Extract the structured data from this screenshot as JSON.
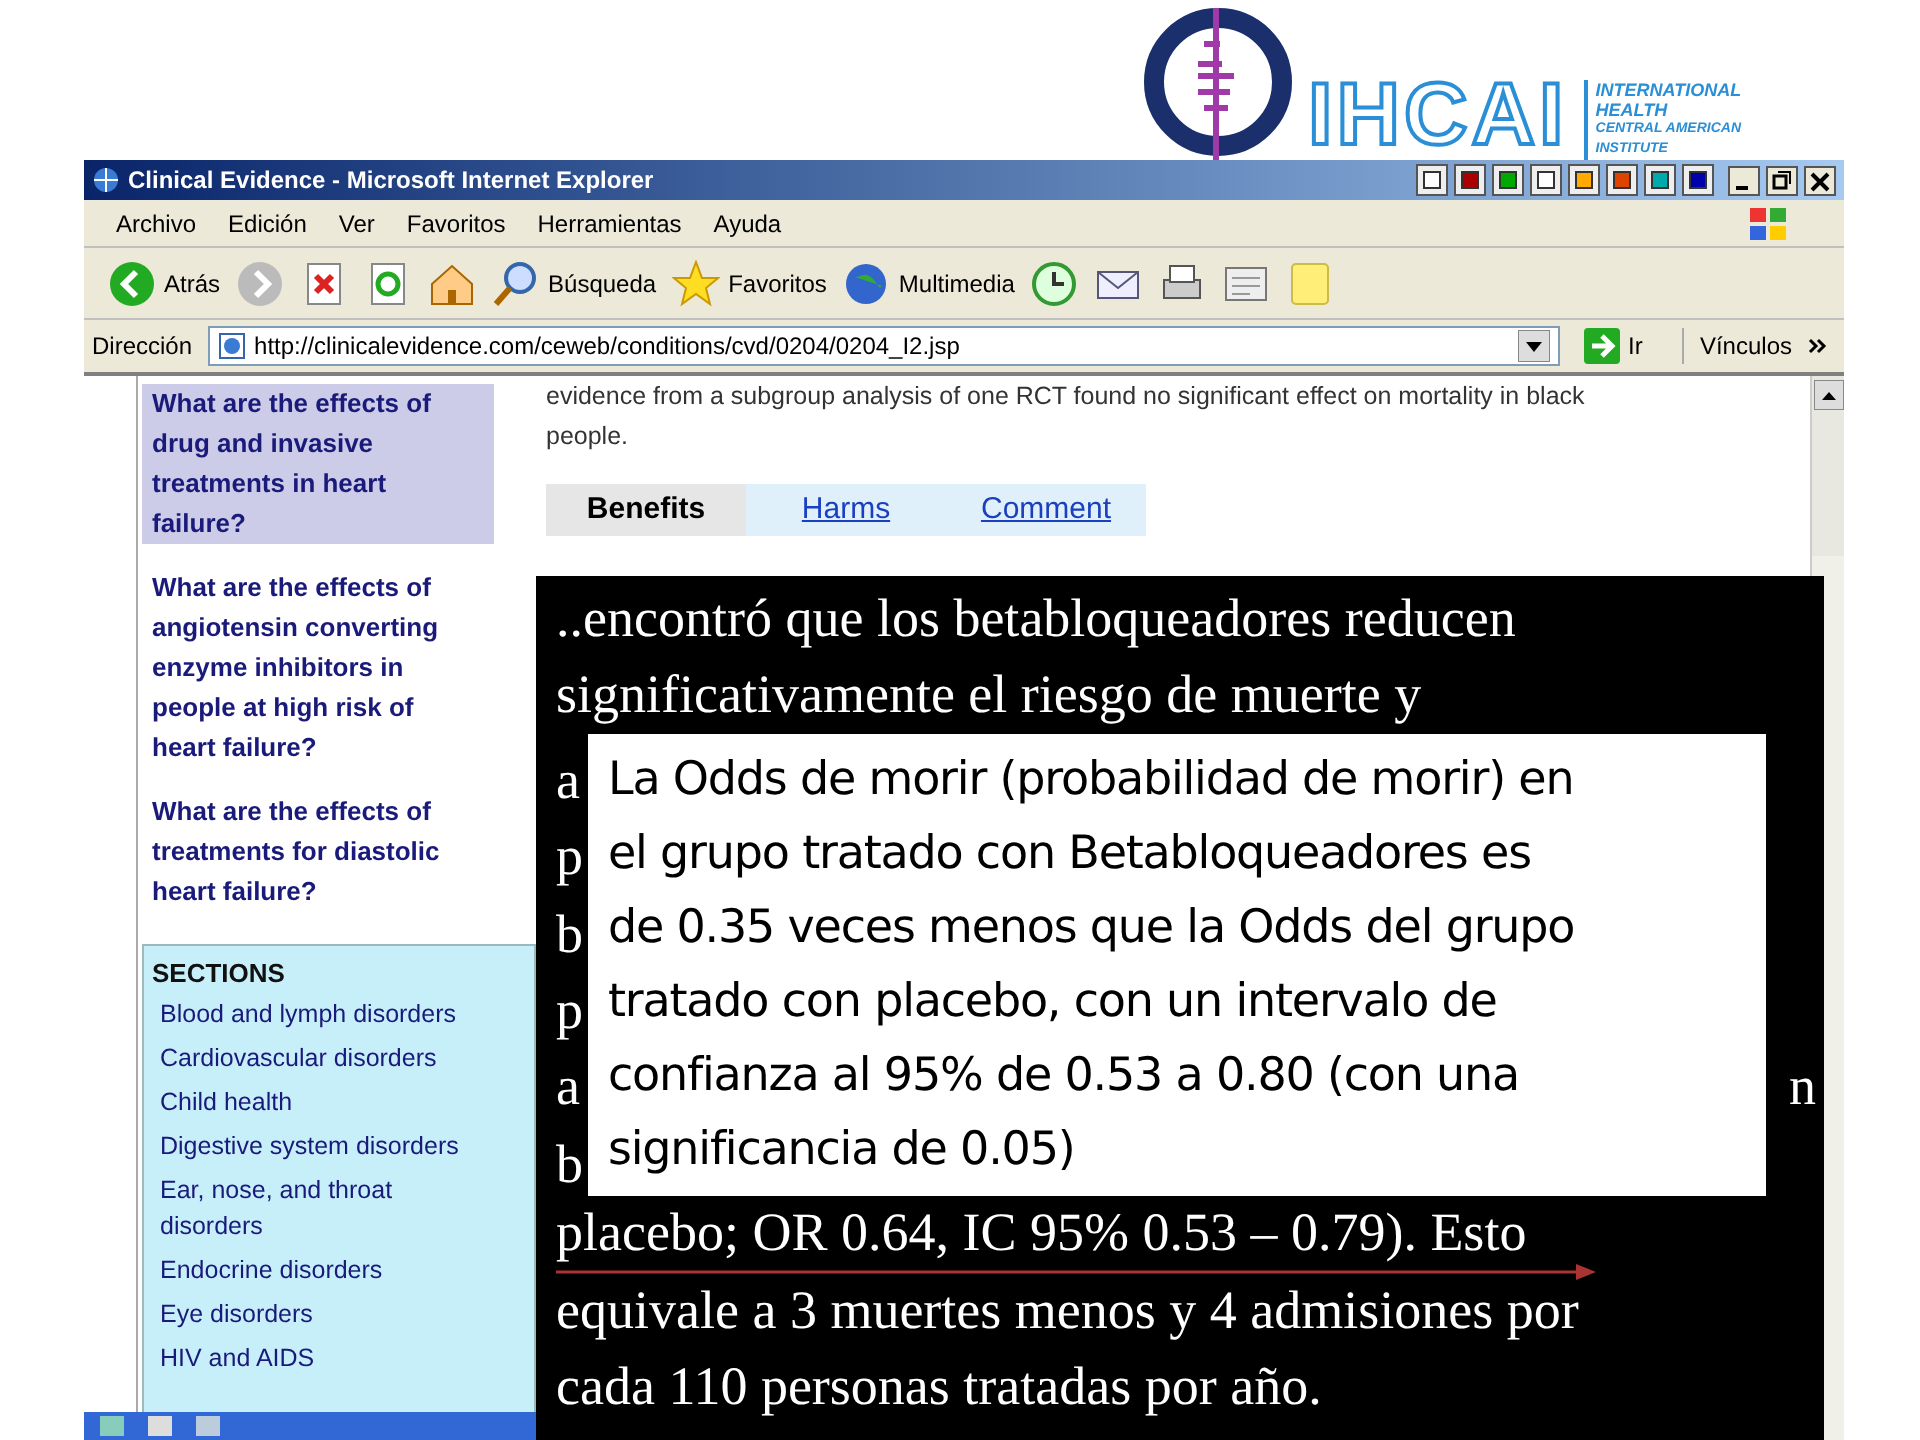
{
  "logo": {
    "name": "IHCAI",
    "subtitle": [
      "INTERNATIONAL",
      "HEALTH",
      "CENTRAL AMERICAN",
      "INSTITUTE"
    ]
  },
  "browser": {
    "title": "Clinical Evidence - Microsoft Internet Explorer",
    "menu": [
      "Archivo",
      "Edición",
      "Ver",
      "Favoritos",
      "Herramientas",
      "Ayuda"
    ],
    "toolbar": [
      {
        "kind": "back",
        "label": "Atrás"
      },
      {
        "kind": "forward"
      },
      {
        "kind": "stop"
      },
      {
        "kind": "refresh"
      },
      {
        "kind": "home"
      },
      {
        "kind": "search",
        "label": "Búsqueda"
      },
      {
        "kind": "favorites",
        "label": "Favoritos"
      },
      {
        "kind": "media",
        "label": "Multimedia"
      },
      {
        "kind": "history"
      },
      {
        "kind": "mail"
      },
      {
        "kind": "print"
      },
      {
        "kind": "edit"
      },
      {
        "kind": "note"
      }
    ],
    "address": {
      "label": "Dirección",
      "url": "http://clinicalevidence.com/ceweb/conditions/cvd/0204/0204_I2.jsp",
      "go": "Ir",
      "links": "Vínculos"
    }
  },
  "sidebar": {
    "questions": [
      {
        "text": "What are the effects of drug and invasive treatments in heart failure?",
        "selected": true
      },
      {
        "text": "What are the effects of angiotensin converting enzyme inhibitors in people at high risk of heart failure?",
        "selected": false
      },
      {
        "text": "What are the effects of treatments for diastolic heart failure?",
        "selected": false
      }
    ],
    "sections": {
      "heading": "SECTIONS",
      "items": [
        "Blood and lymph disorders",
        "Cardiovascular disorders",
        "Child health",
        "Digestive system disorders",
        "Ear, nose, and throat disorders",
        "Endocrine disorders",
        "Eye disorders",
        "HIV and AIDS"
      ]
    }
  },
  "content": {
    "intro": "evidence from a subgroup analysis of one RCT found no significant effect on mortality in black people.",
    "tabs": [
      {
        "label": "Benefits",
        "selected": true
      },
      {
        "label": "Harms",
        "selected": false
      },
      {
        "label": "Comment",
        "selected": false
      }
    ]
  },
  "slide_panel": {
    "lines": [
      {
        "kind": "full",
        "text": "..encontró que los betabloqueadores reducen"
      },
      {
        "kind": "full",
        "text": "significativamente el riesgo de muerte y"
      },
      {
        "kind": "fragment",
        "left": "a"
      },
      {
        "kind": "fragment",
        "left": "p"
      },
      {
        "kind": "fragment",
        "left": "b"
      },
      {
        "kind": "fragment",
        "left": "p"
      },
      {
        "kind": "fragment",
        "left": "a",
        "right": "n"
      },
      {
        "kind": "fragment",
        "left": "b"
      },
      {
        "kind": "full",
        "text": "placebo; OR 0.64, IC 95% 0.53 – 0.79). Esto",
        "arrow": true
      },
      {
        "kind": "full",
        "text": "equivale a 3 muertes menos y 4 admisiones por"
      },
      {
        "kind": "full",
        "text": "cada 110 personas tratadas por año."
      }
    ]
  },
  "callout": {
    "lines": [
      "La Odds de morir (probabilidad de morir) en",
      "el grupo tratado con Betabloqueadores  es",
      "de 0.35 veces menos que la Odds del grupo",
      "tratado con placebo, con un intervalo de",
      "confianza al 95% de 0.53 a 0.80 (con una",
      "significancia de 0.05)"
    ]
  }
}
